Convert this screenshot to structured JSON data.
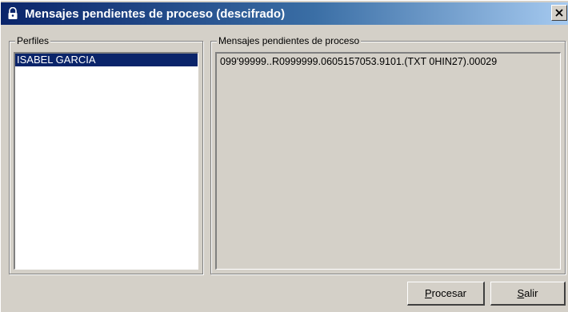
{
  "window": {
    "title": "Mensajes pendientes de proceso (descifrado)",
    "icon": "lock-icon",
    "close_label": "✕"
  },
  "perfiles": {
    "label": "Perfiles",
    "items": [
      {
        "label": "ISABEL GARCIA",
        "selected": true
      }
    ]
  },
  "mensajes": {
    "label": "Mensajes pendientes de proceso",
    "items": [
      {
        "label": "099'99999..R0999999.0605157053.9101.(TXT 0HIN27).00029"
      }
    ]
  },
  "buttons": {
    "procesar": {
      "mnemonic": "P",
      "rest": "rocesar"
    },
    "salir": {
      "mnemonic": "S",
      "rest": "alir"
    }
  },
  "colors": {
    "titlebar_start": "#0a246a",
    "titlebar_end": "#a6caf0",
    "face": "#d4d0c8",
    "selection": "#0a246a"
  }
}
